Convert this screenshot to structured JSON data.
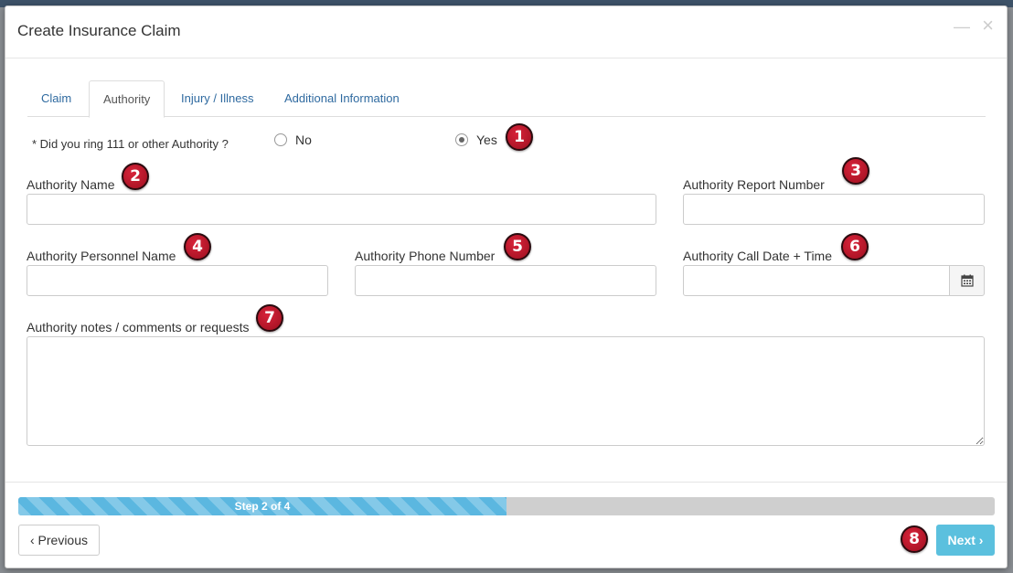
{
  "modal": {
    "title": "Create Insurance Claim",
    "minimize_glyph": "—",
    "close_glyph": "×"
  },
  "tabs": [
    {
      "label": "Claim",
      "active": false
    },
    {
      "label": "Authority",
      "active": true
    },
    {
      "label": "Injury / Illness",
      "active": false
    },
    {
      "label": "Additional Information",
      "active": false
    }
  ],
  "question": {
    "text": "* Did you ring 111 or other Authority ?",
    "options": [
      {
        "label": "No",
        "checked": false
      },
      {
        "label": "Yes",
        "checked": true
      }
    ]
  },
  "fields": {
    "authority_name": {
      "label": "Authority Name",
      "value": ""
    },
    "authority_report_number": {
      "label": "Authority Report Number",
      "value": ""
    },
    "authority_personnel_name": {
      "label": "Authority Personnel Name",
      "value": ""
    },
    "authority_phone_number": {
      "label": "Authority Phone Number",
      "value": ""
    },
    "authority_call_datetime": {
      "label": "Authority Call Date + Time",
      "value": ""
    },
    "authority_notes": {
      "label": "Authority notes / comments or requests",
      "value": ""
    }
  },
  "badges": [
    "1",
    "2",
    "3",
    "4",
    "5",
    "6",
    "7",
    "8"
  ],
  "progress": {
    "label": "Step 2 of 4",
    "percent": 50
  },
  "buttons": {
    "previous": "‹ Previous",
    "next": "Next ›"
  },
  "colors": {
    "accent": "#5bc0de",
    "badge": "#c0182e",
    "tab_link": "#2f6aa0"
  },
  "icons": {
    "calendar": "calendar-icon",
    "close": "close-icon",
    "minimize": "minimize-icon"
  }
}
